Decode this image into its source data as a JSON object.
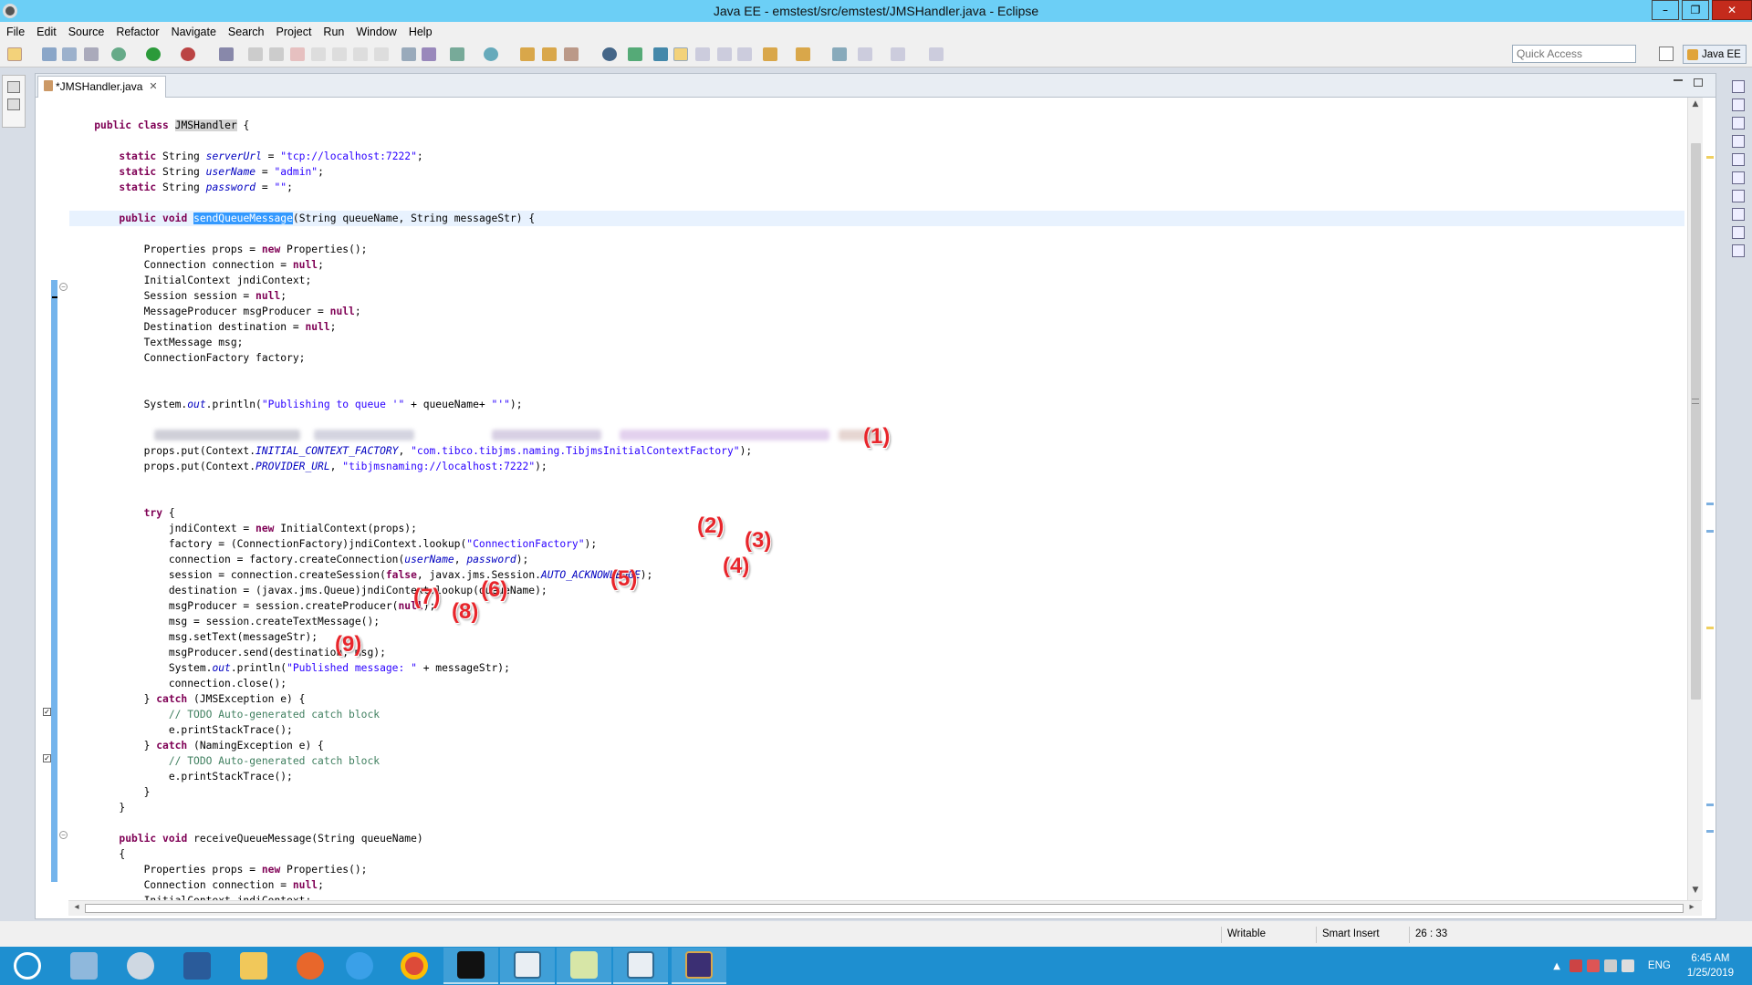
{
  "window": {
    "title": "Java EE - emstest/src/emstest/JMSHandler.java - Eclipse",
    "minimize": "–",
    "maximize": "❐",
    "close": "✕"
  },
  "menu": [
    "File",
    "Edit",
    "Source",
    "Refactor",
    "Navigate",
    "Search",
    "Project",
    "Run",
    "Window",
    "Help"
  ],
  "toolbar": {
    "quick_access_placeholder": "Quick Access",
    "perspective_label": "Java EE"
  },
  "editor": {
    "tab_label": "*JMSHandler.java",
    "tab_close": "✕"
  },
  "code": [
    "",
    "    public class JMSHandler {",
    "",
    "        static String serverUrl = \"tcp://localhost:7222\";",
    "        static String userName = \"admin\";",
    "        static String password = \"\";",
    "",
    "        public void sendQueueMessage(String queueName, String messageStr) {",
    "",
    "            Properties props = new Properties();",
    "            Connection connection = null;",
    "            InitialContext jndiContext;",
    "            Session session = null;",
    "            MessageProducer msgProducer = null;",
    "            Destination destination = null;",
    "            TextMessage msg;",
    "            ConnectionFactory factory;",
    "",
    "",
    "            System.out.println(\"Publishing to queue '\" + queueName+ \"'\");",
    "",
    "",
    "            props.put(Context.INITIAL_CONTEXT_FACTORY, \"com.tibco.tibjms.naming.TibjmsInitialContextFactory\");",
    "            props.put(Context.PROVIDER_URL, \"tibjmsnaming://localhost:7222\");",
    "",
    "",
    "            try {",
    "                jndiContext = new InitialContext(props);",
    "                factory = (ConnectionFactory)jndiContext.lookup(\"ConnectionFactory\");",
    "                connection = factory.createConnection(userName, password);",
    "                session = connection.createSession(false, javax.jms.Session.AUTO_ACKNOWLEDGE);",
    "                destination = (javax.jms.Queue)jndiContext.lookup(queueName);",
    "                msgProducer = session.createProducer(null);",
    "                msg = session.createTextMessage();",
    "                msg.setText(messageStr);",
    "                msgProducer.send(destination, msg);",
    "                System.out.println(\"Published message: \" + messageStr);",
    "                connection.close();",
    "            } catch (JMSException e) {",
    "                // TODO Auto-generated catch block",
    "                e.printStackTrace();",
    "            } catch (NamingException e) {",
    "                // TODO Auto-generated catch block",
    "                e.printStackTrace();",
    "            }",
    "        }",
    "",
    "        public void receiveQueueMessage(String queueName)",
    "        {",
    "            Properties props = new Properties();",
    "            Connection connection = null;",
    "            InitialContext jndiContext;"
  ],
  "annotations": [
    "(1)",
    "(2)",
    "(3)",
    "(4)",
    "(5)",
    "(6)",
    "(7)",
    "(8)",
    "(9)"
  ],
  "status": {
    "writable": "Writable",
    "insert_mode": "Smart Insert",
    "position": "26 : 33"
  },
  "taskbar": {
    "time": "6:45 AM",
    "date": "1/25/2019",
    "language": "ENG"
  },
  "colors": {
    "titlebar": "#6ccff6",
    "taskbar": "#1e8fd0",
    "annotation": "#e8252b",
    "keyword": "#7f0055",
    "string": "#2a00ff",
    "field": "#0000c0",
    "comment": "#3f7f5f"
  }
}
